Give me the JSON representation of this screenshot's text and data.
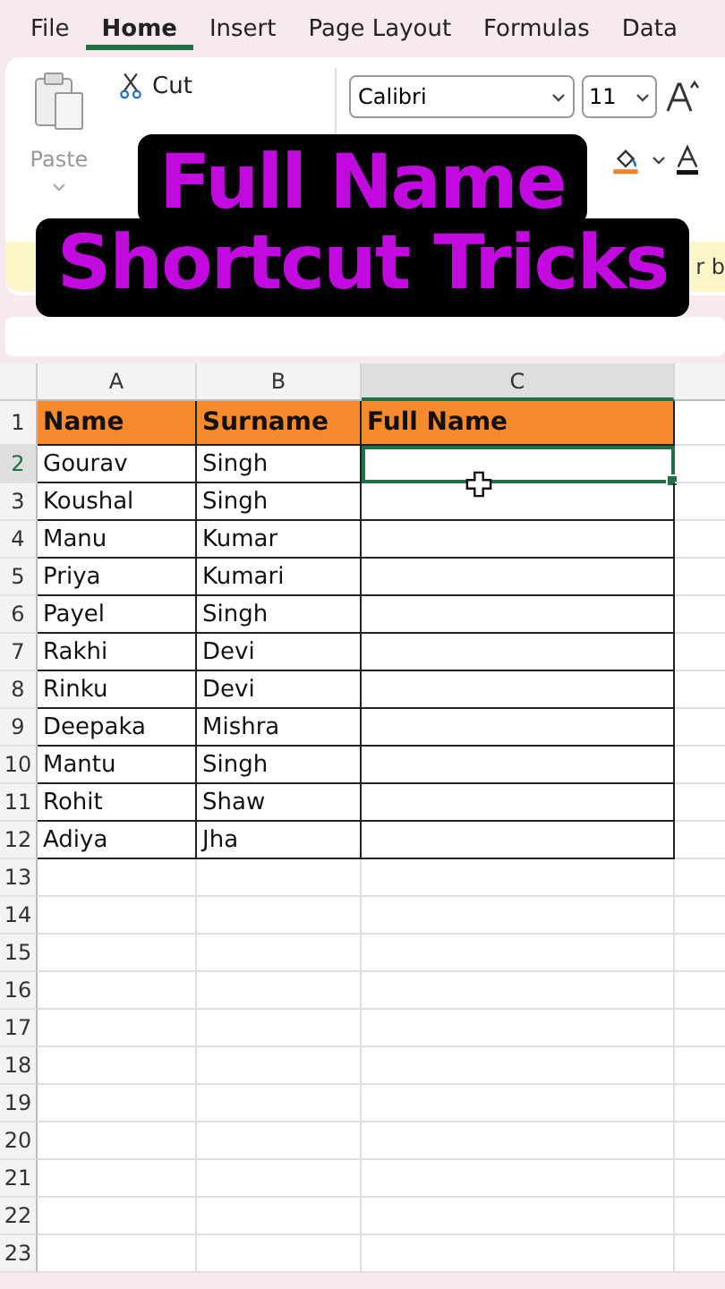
{
  "menu_tabs": [
    {
      "label": "File",
      "selected": false
    },
    {
      "label": "Home",
      "selected": true
    },
    {
      "label": "Insert",
      "selected": false
    },
    {
      "label": "Page Layout",
      "selected": false
    },
    {
      "label": "Formulas",
      "selected": false
    },
    {
      "label": "Data",
      "selected": false
    }
  ],
  "clipboard": {
    "paste": "Paste",
    "cut": "Cut"
  },
  "font": {
    "name": "Calibri",
    "size": "11"
  },
  "message_bar": {
    "text": "r b"
  },
  "overlay_title": [
    "Full Name",
    "Shortcut Tricks"
  ],
  "sheet": {
    "columns": [
      {
        "label": "A",
        "selected": false
      },
      {
        "label": "B",
        "selected": false
      },
      {
        "label": "C",
        "selected": true
      }
    ],
    "rows": [
      {
        "number": "1",
        "kind": "header",
        "selected": false,
        "cells": [
          "Name",
          "Surname",
          "Full Name"
        ]
      },
      {
        "number": "2",
        "kind": "data",
        "selected": true,
        "cells": [
          "Gourav",
          "Singh"
        ]
      },
      {
        "number": "3",
        "kind": "data",
        "selected": false,
        "cells": [
          "Koushal",
          "Singh"
        ]
      },
      {
        "number": "4",
        "kind": "data",
        "selected": false,
        "cells": [
          "Manu",
          "Kumar"
        ]
      },
      {
        "number": "5",
        "kind": "data",
        "selected": false,
        "cells": [
          "Priya",
          "Kumari"
        ]
      },
      {
        "number": "6",
        "kind": "data",
        "selected": false,
        "cells": [
          "Payel",
          "Singh"
        ]
      },
      {
        "number": "7",
        "kind": "data",
        "selected": false,
        "cells": [
          "Rakhi",
          "Devi"
        ]
      },
      {
        "number": "8",
        "kind": "data",
        "selected": false,
        "cells": [
          "Rinku",
          "Devi"
        ]
      },
      {
        "number": "9",
        "kind": "data",
        "selected": false,
        "cells": [
          "Deepaka",
          "Mishra"
        ]
      },
      {
        "number": "10",
        "kind": "data",
        "selected": false,
        "cells": [
          "Mantu",
          "Singh"
        ]
      },
      {
        "number": "11",
        "kind": "data",
        "selected": false,
        "cells": [
          "Rohit",
          "Shaw"
        ]
      },
      {
        "number": "12",
        "kind": "data",
        "selected": false,
        "cells": [
          "Adiya",
          "Jha"
        ]
      }
    ],
    "empty_rows": [
      "13",
      "14",
      "15",
      "16",
      "17",
      "18",
      "19",
      "20",
      "21",
      "22",
      "23"
    ]
  }
}
